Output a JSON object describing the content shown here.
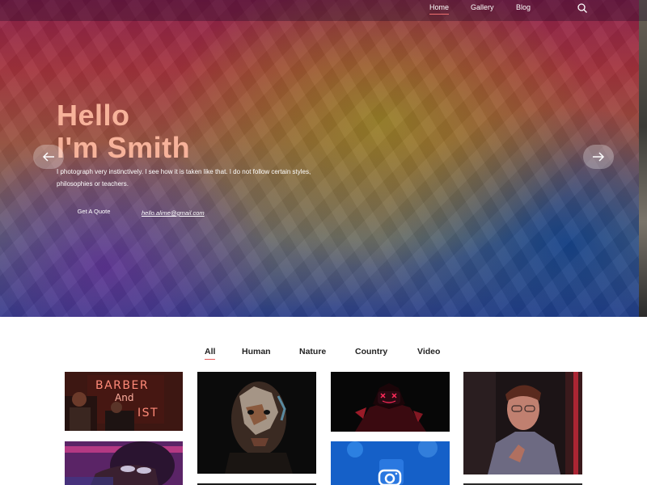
{
  "nav": {
    "items": [
      {
        "label": "Home",
        "active": true
      },
      {
        "label": "Gallery",
        "active": false
      },
      {
        "label": "Blog",
        "active": false
      }
    ],
    "search_icon": "search-icon"
  },
  "hero": {
    "title_line1": "Hello",
    "title_line2": "I'm Smith",
    "description": "I photograph very instinctively. I see how it is taken like that. I do not follow certain styles, philosophies or teachers.",
    "quote_button": "Get A Quote",
    "email": "hello.alime@gmail.com",
    "prev_icon": "arrow-left-icon",
    "next_icon": "arrow-right-icon",
    "colors": {
      "title": "#f7b29a",
      "accent": "#e25a5a"
    }
  },
  "filters": {
    "tabs": [
      {
        "label": "All",
        "active": true
      },
      {
        "label": "Human",
        "active": false
      },
      {
        "label": "Nature",
        "active": false
      },
      {
        "label": "Country",
        "active": false
      },
      {
        "label": "Video",
        "active": false
      }
    ]
  },
  "gallery": {
    "neon_sign_line1": "BARBER",
    "neon_sign_line2": "And",
    "neon_sign_line3": "IST"
  }
}
